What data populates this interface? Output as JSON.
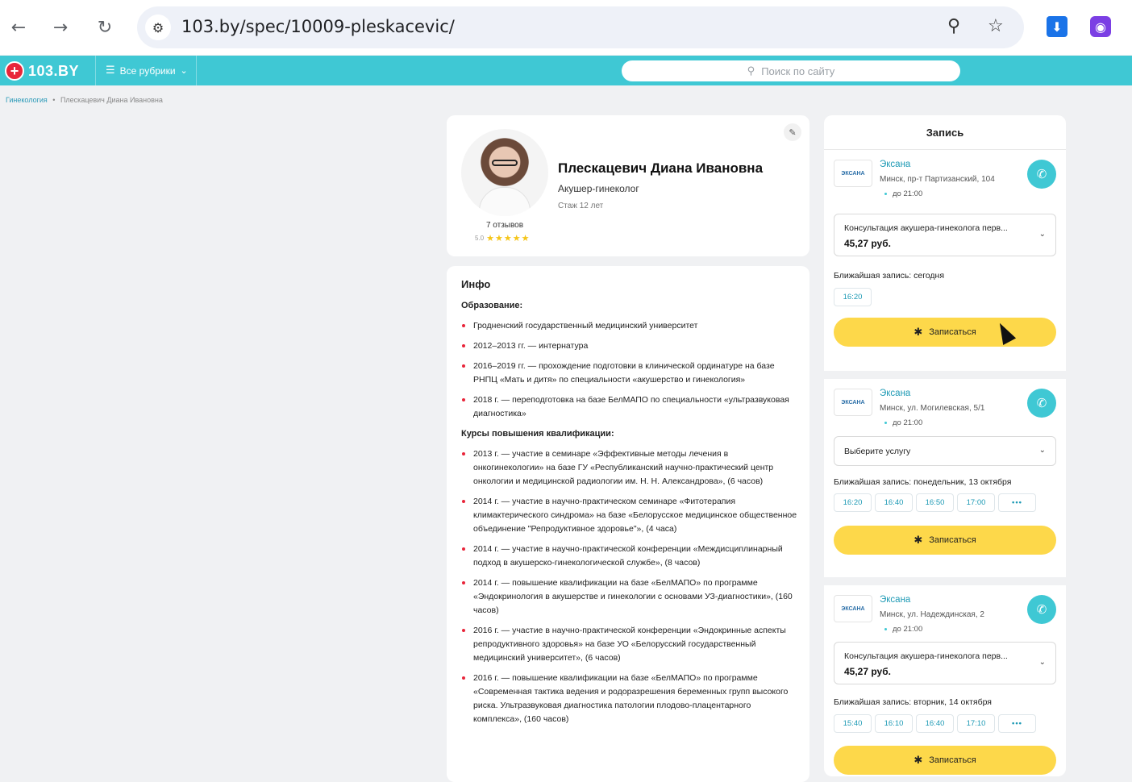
{
  "browser": {
    "url": "103.by/spec/10009-pleskacevic/",
    "back_icon": "←",
    "forward_icon": "→",
    "reload_icon": "↻",
    "site_settings_icon": "⚙",
    "zoom_icon": "⚲",
    "bookmark_icon": "☆",
    "download_icon": "⬇",
    "extension_icon": "◉"
  },
  "site": {
    "logo_mark": "+",
    "logo_text": "103.BY",
    "rubrics_label": "Все рубрики",
    "rubrics_icon": "☰",
    "rubrics_chevron": "⌄",
    "search_placeholder": "Поиск по сайту",
    "search_icon": "⚲",
    "accent_color": "#3fc8d4",
    "button_color": "#fdd84a"
  },
  "breadcrumb": {
    "items": [
      "Гинекология",
      "Плескацевич Диана Ивановна"
    ],
    "separator": "•"
  },
  "profile": {
    "name": "Плескацевич Диана Ивановна",
    "specialty": "Акушер-гинеколог",
    "experience": "Стаж 12 лет",
    "reviews": "7 отзывов",
    "rating_value": "5.0",
    "stars": "★★★★★",
    "edit_icon": "✎"
  },
  "info": {
    "title": "Инфо",
    "education_heading": "Образование:",
    "education": [
      "Гродненский государственный медицинский университет",
      "2012–2013 гг. — интернатура",
      "2016–2019 гг. — прохождение подготовки в клинической ординатуре на базе РНПЦ «Мать и дитя» по специальности «акушерство и гинекология»",
      "2018 г. — переподготовка на базе БелМАПО по специальности «ультразвуковая диагностика»"
    ],
    "courses_heading": "Курсы повышения квалификации:",
    "courses": [
      "2013 г. — участие в семинаре «Эффективные методы лечения в онкогинекологии» на базе ГУ «Республиканский научно-практический центр онкологии и медицинской радиологии им. Н. Н. Александрова», (6 часов)",
      "2014 г. — участие в научно-практическом семинаре «Фитотерапия климактерического синдрома» на базе «Белорусское медицинское общественное объединение \"Репродуктивное здоровье\"», (4 часа)",
      "2014 г. — участие в научно-практической конференции «Междисциплинарный подход в акушерско-гинекологической службе», (8 часов)",
      "2014 г. — повышение квалификации на базе «БелМАПО» по программе «Эндокринология в акушерстве и гинекологии с основами УЗ-диагностики», (160 часов)",
      "2016 г. — участие в научно-практической конференции «Эндокринные аспекты репродуктивного здоровья» на базе УО «Белорусский государственный медицинский университет», (6 часов)",
      "2016 г. — повышение квалификации на базе «БелМАПО» по программе «Современная тактика ведения и родоразрешения беременных групп высокого риска. Ультразвуковая диагностика патологии плодово-плацентарного комплекса», (160 часов)"
    ]
  },
  "booking": {
    "title": "Запись",
    "book_label": "Записаться",
    "book_icon": "✱",
    "phone_icon": "✆",
    "chevron": "⌄",
    "clinic_logo_text": "ЭКСАНА",
    "branches": [
      {
        "name": "Эксана",
        "address": "Минск, пр-т Партизанский, 104",
        "hours": "до 21:00",
        "service": "Консультация акушера-гинеколога перв...",
        "price": "45,27 руб.",
        "nearest": "Ближайшая запись: сегодня",
        "slots": [
          "16:20"
        ]
      },
      {
        "name": "Эксана",
        "address": "Минск, ул. Могилевская, 5/1",
        "hours": "до 21:00",
        "service": "Выберите услугу",
        "price": "",
        "nearest": "Ближайшая запись: понедельник, 13 октября",
        "slots": [
          "16:20",
          "16:40",
          "16:50",
          "17:00"
        ],
        "more": "•••"
      },
      {
        "name": "Эксана",
        "address": "Минск, ул. Надеждинская, 2",
        "hours": "до 21:00",
        "service": "Консультация акушера-гинеколога перв...",
        "price": "45,27 руб.",
        "nearest": "Ближайшая запись: вторник, 14 октября",
        "slots": [
          "15:40",
          "16:10",
          "16:40",
          "17:10"
        ],
        "more": "•••"
      }
    ]
  }
}
